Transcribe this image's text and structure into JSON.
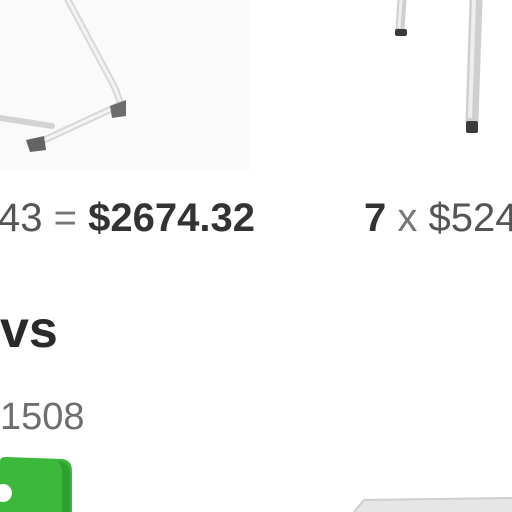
{
  "left_card": {
    "calc": {
      "qty_tail": "43",
      "equals": "=",
      "total": "$2674.32"
    },
    "heading_fragment": "vs",
    "number_fragment": "1508",
    "image_icon": "chair-frame-image",
    "thumb_accent": "#3cb83a"
  },
  "right_card": {
    "calc": {
      "qty": "7",
      "times": "x",
      "price_fragment": "$524"
    },
    "image_icon": "chair-legs-image"
  }
}
